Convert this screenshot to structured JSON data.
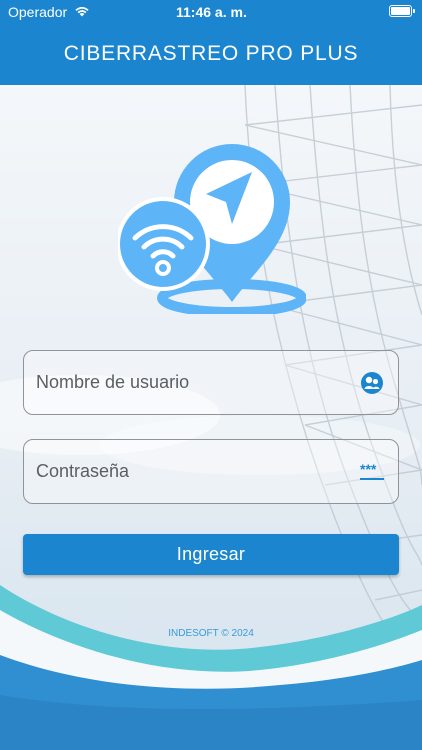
{
  "status_bar": {
    "carrier": "Operador",
    "time": "11:46 a. m."
  },
  "header": {
    "title": "CIBERRASTREO PRO PLUS"
  },
  "login_form": {
    "username_placeholder": "Nombre de usuario",
    "password_placeholder": "Contraseña",
    "submit_label": "Ingresar"
  },
  "footer": {
    "copyright": "INDESOFT © 2024"
  },
  "colors": {
    "primary": "#1b86cf",
    "logo": "#5db4f7",
    "wave_teal": "#5fc9d6"
  },
  "icons": {
    "wifi": "wifi-icon",
    "battery": "battery-icon",
    "user": "users-icon",
    "password": "password-dots-icon"
  }
}
